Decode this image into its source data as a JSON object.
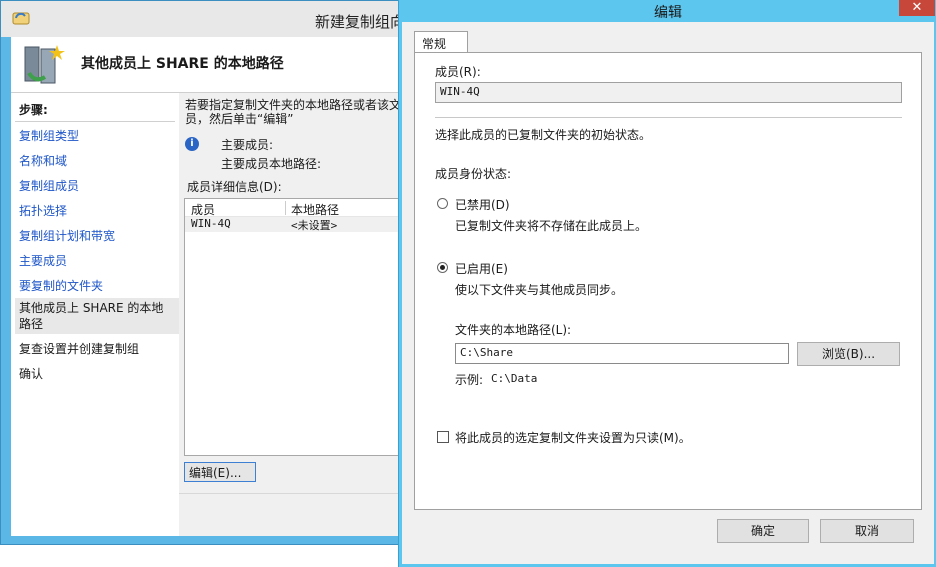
{
  "wizard": {
    "title": "新建复制组向",
    "header_title": "其他成员上 SHARE 的本地路径",
    "steps_heading": "步骤:",
    "steps": [
      "复制组类型",
      "名称和域",
      "复制组成员",
      "拓扑选择",
      "复制组计划和带宽",
      "主要成员",
      "要复制的文件夹",
      "其他成员上 SHARE 的本地路径",
      "复查设置并创建复制组",
      "确认"
    ],
    "intro_text": "若要指定复制文件夹的本地路径或者该文 成员，然后单击“编辑”",
    "primary_member_label": "主要成员:",
    "primary_member_path_label": "主要成员本地路径:",
    "member_details_label": "成员详细信息(D):",
    "columns": [
      "成员",
      "本地路径"
    ],
    "rows": [
      {
        "member": "WIN-4Q",
        "path": "<未设置>"
      }
    ],
    "edit_button": "编辑(E)..."
  },
  "dialog": {
    "title": "编辑",
    "close_glyph": "✕",
    "tab": "常规",
    "member_label": "成员(R):",
    "member_value": "WIN-4Q",
    "initial_state_text": "选择此成员的已复制文件夹的初始状态。",
    "membership_status_label": "成员身份状态:",
    "disabled_option": "已禁用(D)",
    "disabled_desc": "已复制文件夹将不存储在此成员上。",
    "enabled_option": "已启用(E)",
    "enabled_desc": "使以下文件夹与其他成员同步。",
    "local_path_label": "文件夹的本地路径(L):",
    "local_path_value": "C:\\Share",
    "browse_button": "浏览(B)...",
    "example_label": "示例:",
    "example_value": "C:\\Data",
    "readonly_checkbox": "将此成员的选定复制文件夹设置为只读(M)。",
    "ok_button": "确定",
    "cancel_button": "取消"
  }
}
